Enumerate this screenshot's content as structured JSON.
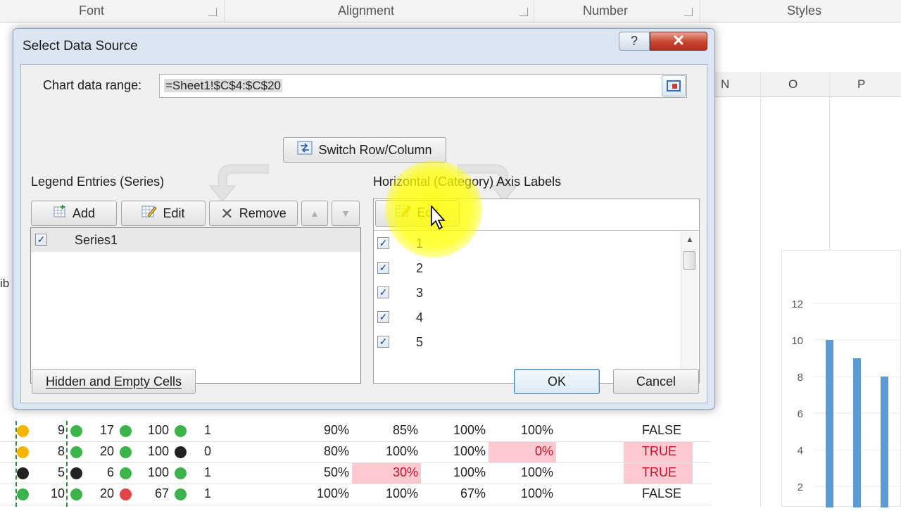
{
  "ribbon": {
    "groups": [
      "Font",
      "Alignment",
      "Number",
      "Styles"
    ]
  },
  "sheet": {
    "columns": [
      "N",
      "O",
      "P"
    ],
    "chart_axis": [
      "12",
      "10",
      "8",
      "6",
      "4",
      "2"
    ],
    "chart_bars": [
      10,
      9,
      8
    ],
    "partial_text": "ib",
    "rows": [
      {
        "a": "9",
        "b": "17",
        "c": "100",
        "d": "1",
        "e": "90%",
        "f": "85%",
        "g": "100%",
        "h": "100%",
        "i": "FALSE",
        "dots": [
          "#f5b400",
          "#3cb44b",
          "#3cb44b",
          "#3cb44b"
        ]
      },
      {
        "a": "8",
        "b": "20",
        "c": "100",
        "d": "0",
        "e": "80%",
        "f": "100%",
        "g": "100%",
        "h": "0%",
        "i": "TRUE",
        "dots": [
          "#f5b400",
          "#3cb44b",
          "#3cb44b",
          "#222222"
        ]
      },
      {
        "a": "5",
        "b": "6",
        "c": "100",
        "d": "1",
        "e": "50%",
        "f": "30%",
        "g": "100%",
        "h": "100%",
        "i": "TRUE",
        "dots": [
          "#222222",
          "#222222",
          "#3cb44b",
          "#3cb44b"
        ]
      },
      {
        "a": "10",
        "b": "20",
        "c": "67",
        "d": "1",
        "e": "100%",
        "f": "100%",
        "g": "67%",
        "h": "100%",
        "i": "FALSE",
        "dots": [
          "#3cb44b",
          "#3cb44b",
          "#e04646",
          "#3cb44b"
        ]
      }
    ]
  },
  "dialog": {
    "title": "Select Data Source",
    "help_label": "?",
    "close_label": "✕",
    "range_label": "Chart data range:",
    "range_value": "=Sheet1!$C$4:$C$20",
    "switch_label": "Switch Row/Column",
    "legend": {
      "heading": "Legend Entries (Series)",
      "add_label": "Add",
      "edit_label": "Edit",
      "remove_label": "Remove",
      "up_label": "▲",
      "down_label": "▼",
      "items": [
        {
          "label": "Series1",
          "checked": true
        }
      ]
    },
    "axis": {
      "heading": "Horizontal (Category) Axis Labels",
      "edit_label": "Edit",
      "items": [
        {
          "label": "1",
          "checked": true
        },
        {
          "label": "2",
          "checked": true
        },
        {
          "label": "3",
          "checked": true
        },
        {
          "label": "4",
          "checked": true
        },
        {
          "label": "5",
          "checked": true
        }
      ]
    },
    "hidden_cells_label": "Hidden and Empty Cells",
    "ok_label": "OK",
    "cancel_label": "Cancel"
  },
  "colors": {
    "dialog_frame": "#dce6f2",
    "chart_bar": "#5b9bd5",
    "highlight": "#ffff00",
    "pink_fill": "#fbc9cf"
  }
}
